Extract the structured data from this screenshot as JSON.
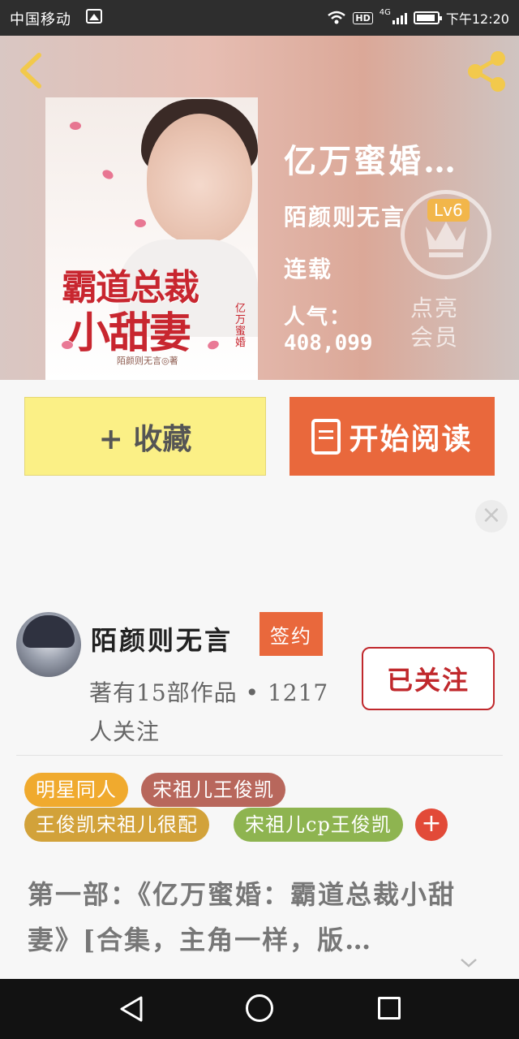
{
  "status_bar": {
    "carrier": "中国移动",
    "network": "4G",
    "hd": "HD",
    "time": "下午12:20"
  },
  "header": {
    "title": "亿万蜜婚…",
    "author": "陌颜则无言",
    "status": "连载",
    "popularity_label": "人气：",
    "popularity_value": "408,099",
    "level_badge": "Lv6",
    "member_prompt": [
      "点亮",
      "会员"
    ],
    "cover": {
      "title_line1": "霸道总裁",
      "title_line2": "小甜妻",
      "subtitle": "亿万蜜婚",
      "author": "陌颜则无言◎著"
    }
  },
  "actions": {
    "favorite_label": "+ 收藏",
    "read_label": "开始阅读"
  },
  "author_card": {
    "name": "陌颜则无言",
    "signed_badge": "签约",
    "works_info": "著有15部作品 • 1217 人关注",
    "follow_label": "已关注"
  },
  "tags": [
    {
      "label": "明星同人",
      "color": "#f0aa2e"
    },
    {
      "label": "宋祖儿王俊凯",
      "color": "#b8675c"
    },
    {
      "label": "王俊凯宋祖儿很配",
      "color": "#d2a23a"
    },
    {
      "label": "宋祖儿cp王俊凯",
      "color": "#8eb450"
    }
  ],
  "description": "第一部：《亿万蜜婚：霸道总裁小甜妻》[合集，主角一样，版…",
  "icons": {
    "back": "chevron-left-icon",
    "share": "share-icon",
    "crown": "crown-icon",
    "close": "close-icon",
    "expand": "chevron-down-icon",
    "book": "book-icon"
  },
  "colors": {
    "accent_orange": "#e9683c",
    "favorite_yellow": "#fbf086",
    "follow_red": "#c0282c",
    "share_yellow": "#f2c94c"
  }
}
